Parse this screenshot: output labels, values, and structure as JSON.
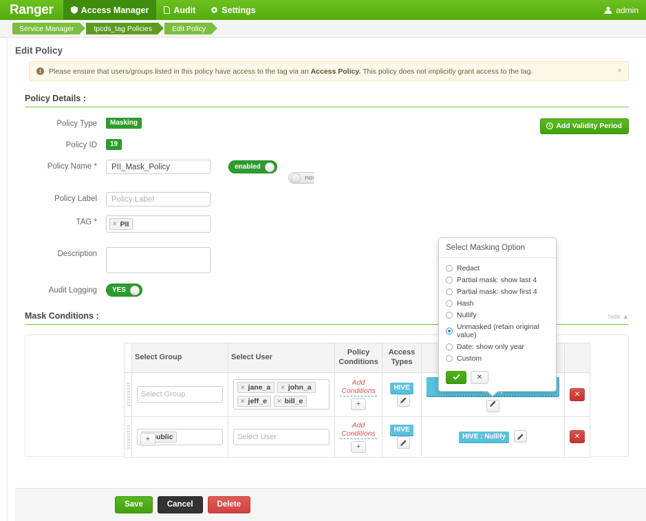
{
  "topnav": {
    "brand": "Ranger",
    "items": [
      {
        "label": "Access Manager",
        "icon": "shield-icon",
        "active": true
      },
      {
        "label": "Audit",
        "icon": "file-icon",
        "active": false
      },
      {
        "label": "Settings",
        "icon": "gear-icon",
        "active": false
      }
    ],
    "user": "admin",
    "user_icon": "user-icon"
  },
  "breadcrumb": {
    "items": [
      {
        "label": "Service Manager"
      },
      {
        "label": "tpcds_tag Policies"
      },
      {
        "label": "Edit Policy"
      }
    ]
  },
  "page": {
    "title": "Edit Policy"
  },
  "alert": {
    "icon": "info-icon",
    "text_before": "Please ensure that users/groups listed in this policy have access to the tag via an ",
    "bold": "Access Policy.",
    "text_after": " This policy does not implicitly grant access to the tag.",
    "close": "×"
  },
  "policy_details": {
    "section_title": "Policy Details :",
    "add_validity_label": "Add Validity Period",
    "add_validity_icon": "clock-icon",
    "fields": {
      "policy_type_label": "Policy Type",
      "policy_type_value": "Masking",
      "policy_id_label": "Policy ID",
      "policy_id_value": "19",
      "policy_name_label": "Policy Name *",
      "policy_name_value": "PII_Mask_Policy",
      "policy_label_label": "Policy Label",
      "policy_label_placeholder": "Policy Label",
      "policy_label_value": "",
      "tag_label": "TAG *",
      "tag_value": "PII",
      "description_label": "Description",
      "description_value": "",
      "audit_logging_label": "Audit Logging",
      "audit_logging_value": "YES"
    },
    "toggles": {
      "enabled_label": "enabled",
      "normal_label": "nor"
    }
  },
  "mask_conditions": {
    "section_title": "Mask Conditions :",
    "hide_label": "hide ▲",
    "columns": [
      "Select Group",
      "Select User",
      "Policy Conditions",
      "Access Types",
      ""
    ],
    "add_row_label": "+",
    "rows": [
      {
        "groups": [],
        "group_placeholder": "Select Group",
        "users": [
          "jane_a",
          "john_a",
          "jeff_e",
          "bill_e"
        ],
        "user_placeholder": "",
        "conditions_label": "Add Conditions",
        "conditions_plus": "+",
        "access_type": "HIVE",
        "edit_icon": "pencil-icon",
        "mask_label": "HIVE : Unmasked (retain original value)",
        "mask_edit_icon": "pencil-icon",
        "delete_icon": "remove-icon"
      },
      {
        "groups": [
          "public"
        ],
        "group_placeholder": "",
        "users": [],
        "user_placeholder": "Select User",
        "conditions_label": "Add Conditions",
        "conditions_plus": "+",
        "access_type": "HIVE",
        "edit_icon": "pencil-icon",
        "mask_label": "HIVE : Nullify",
        "mask_edit_icon": "pencil-icon",
        "delete_icon": "remove-icon"
      }
    ]
  },
  "masking_popup": {
    "title": "Select Masking Option",
    "options": [
      {
        "label": "Redact",
        "selected": false
      },
      {
        "label": "Partial mask: show last 4",
        "selected": false
      },
      {
        "label": "Partial mask: show first 4",
        "selected": false
      },
      {
        "label": "Hash",
        "selected": false
      },
      {
        "label": "Nullify",
        "selected": false
      },
      {
        "label": "Unmasked (retain original value)",
        "selected": true
      },
      {
        "label": "Date: show only year",
        "selected": false
      },
      {
        "label": "Custom",
        "selected": false
      }
    ],
    "confirm_icon": "check-icon",
    "cancel_icon": "close-icon"
  },
  "footer": {
    "save": "Save",
    "cancel": "Cancel",
    "delete": "Delete"
  },
  "colors": {
    "brand_green": "#5cb615",
    "badge_green": "#2d9c2d",
    "info_blue": "#5bc0de",
    "danger_red": "#d9534f",
    "radio_blue": "#2b8fd4"
  }
}
